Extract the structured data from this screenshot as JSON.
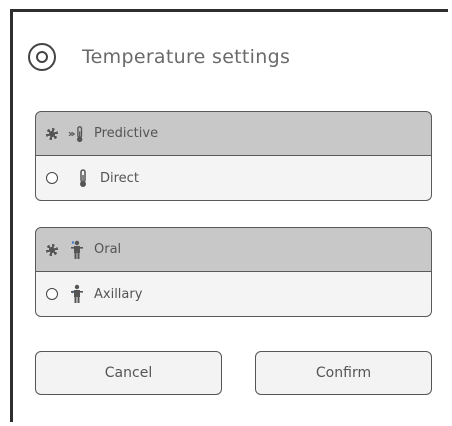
{
  "dialog": {
    "title": "Temperature settings",
    "icon": "radio-target-icon"
  },
  "measurement_mode": {
    "options": [
      {
        "label": "Predictive",
        "icon": "predictive-thermometer-icon",
        "selected": true
      },
      {
        "label": "Direct",
        "icon": "thermometer-icon",
        "selected": false
      }
    ]
  },
  "measurement_site": {
    "options": [
      {
        "label": "Oral",
        "icon": "oral-person-icon",
        "selected": true
      },
      {
        "label": "Axillary",
        "icon": "axillary-person-icon",
        "selected": false
      }
    ]
  },
  "buttons": {
    "cancel": "Cancel",
    "confirm": "Confirm"
  }
}
